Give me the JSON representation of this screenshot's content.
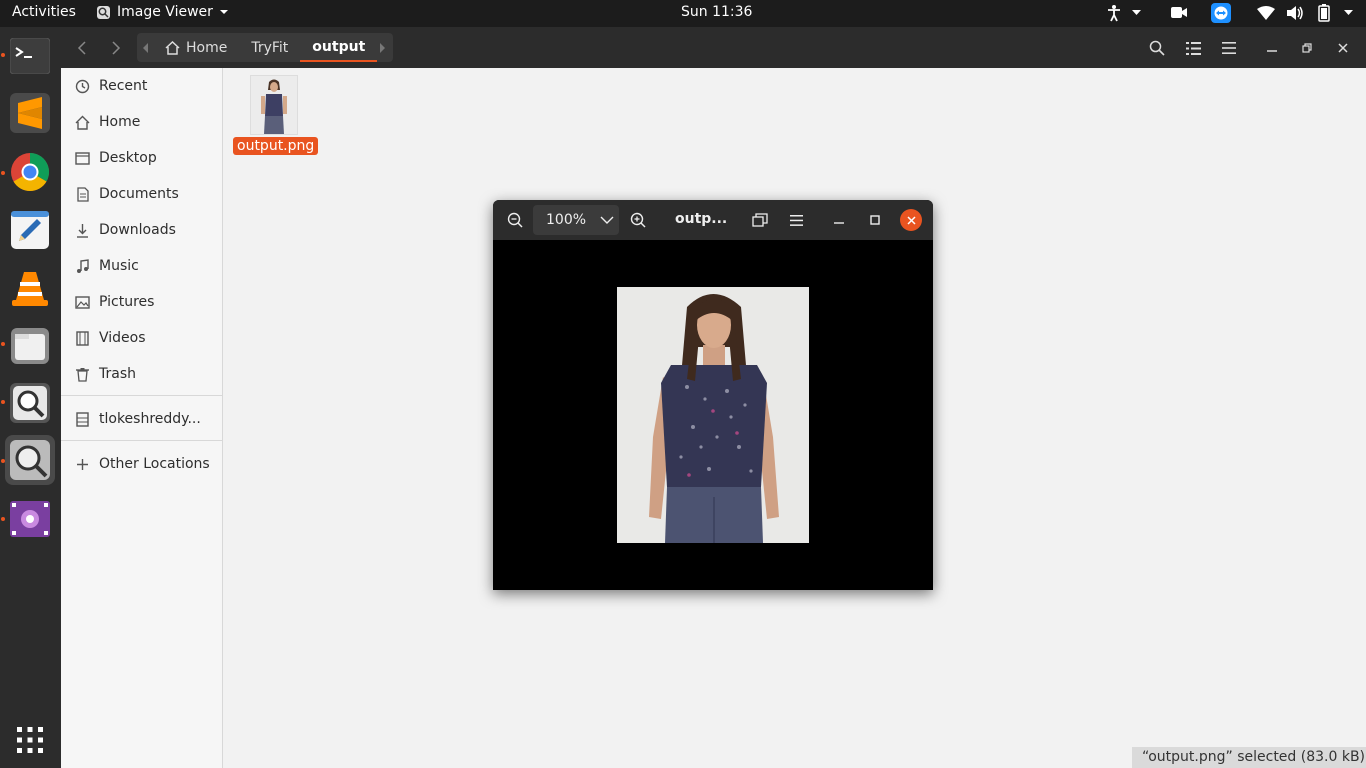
{
  "topbar": {
    "activities": "Activities",
    "app_name": "Image Viewer",
    "clock": "Sun 11:36",
    "icons": [
      "accessibility-icon",
      "camera-icon",
      "teamviewer-icon",
      "wifi-icon",
      "volume-icon",
      "battery-icon",
      "power-menu-icon"
    ]
  },
  "dock": {
    "apps": [
      "terminal",
      "sublime-text",
      "chrome",
      "text-editor",
      "vlc",
      "files",
      "image-viewer",
      "magnifier",
      "video-player"
    ],
    "show_apps": "show-applications"
  },
  "files": {
    "breadcrumb": [
      "Home",
      "TryFit",
      "output"
    ],
    "sidebar": {
      "items": [
        "Recent",
        "Home",
        "Desktop",
        "Documents",
        "Downloads",
        "Music",
        "Pictures",
        "Videos",
        "Trash"
      ],
      "device": "tlokeshreddy...",
      "other": "Other Locations"
    },
    "file_name": "output.png",
    "status": "“output.png” selected  (83.0 kB)"
  },
  "viewer": {
    "zoom": "100%",
    "title": "outp..."
  },
  "colors": {
    "accent": "#e95420",
    "headerbar": "#2c2c2c",
    "topbar": "#1c1c1c",
    "dock": "#2c2c2c"
  }
}
